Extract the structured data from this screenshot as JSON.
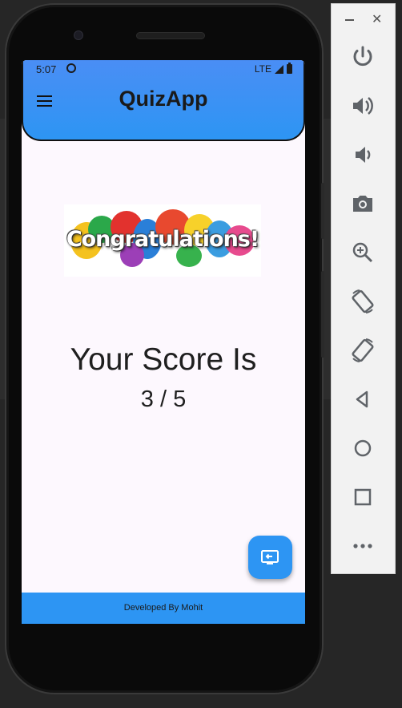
{
  "status_bar": {
    "time": "5:07",
    "network": "LTE"
  },
  "app_bar": {
    "title": "QuizApp"
  },
  "banner": {
    "text": "Congratulations!"
  },
  "result": {
    "heading": "Your Score Is",
    "score": "3 / 5"
  },
  "footer": {
    "text": "Developed By Mohit"
  },
  "colors": {
    "primary": "#2d95f3",
    "icon_gray": "#5f6368",
    "screen_bg": "#fdf8fe"
  },
  "emulator_panel": {
    "tools": [
      "power-icon",
      "volume-up-icon",
      "volume-down-icon",
      "camera-icon",
      "zoom-icon",
      "rotate-left-icon",
      "rotate-right-icon",
      "back-icon",
      "home-icon",
      "overview-icon",
      "more-icon"
    ]
  }
}
